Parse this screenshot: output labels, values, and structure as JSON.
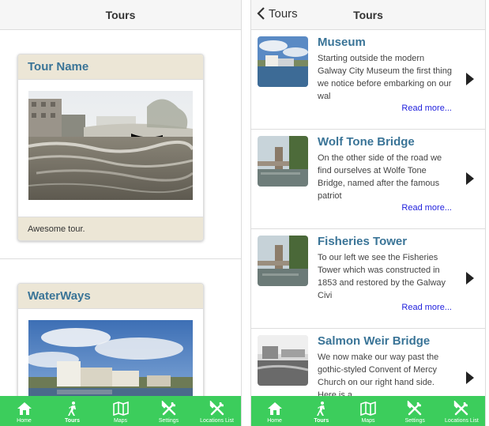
{
  "left": {
    "header_title": "Tours",
    "cards": [
      {
        "title": "Tour Name",
        "description": "Awesome tour."
      },
      {
        "title": "WaterWays"
      }
    ]
  },
  "right": {
    "back_label": "Tours",
    "header_title": "Tours",
    "items": [
      {
        "title": "Museum",
        "text": "Starting outside the modern Galway City Museum the first thing we notice before embarking on our wal",
        "read_more": "Read more..."
      },
      {
        "title": "Wolf Tone Bridge",
        "text": "On the other side of the road we find ourselves at Wolfe Tone Bridge, named after the famous patriot",
        "read_more": "Read more..."
      },
      {
        "title": "Fisheries Tower",
        "text": "To our left we see the Fisheries Tower which was constructed in 1853 and restored by the Galway Civi",
        "read_more": "Read more..."
      },
      {
        "title": "Salmon Weir Bridge",
        "text": "We now make our way past the gothic-styled Convent of Mercy Church on our right hand side. Here is a",
        "read_more": ""
      }
    ]
  },
  "tabs": [
    {
      "label": "Home",
      "icon": "home-icon"
    },
    {
      "label": "Tours",
      "icon": "walker-icon",
      "active": true
    },
    {
      "label": "Maps",
      "icon": "map-icon"
    },
    {
      "label": "Settings",
      "icon": "tools-icon"
    },
    {
      "label": "Locations List",
      "icon": "tools-icon"
    }
  ],
  "colors": {
    "accent_green": "#3ccd5c",
    "card_header": "#ece6d6",
    "title_blue": "#3a7497",
    "link_blue": "#2222dd"
  }
}
